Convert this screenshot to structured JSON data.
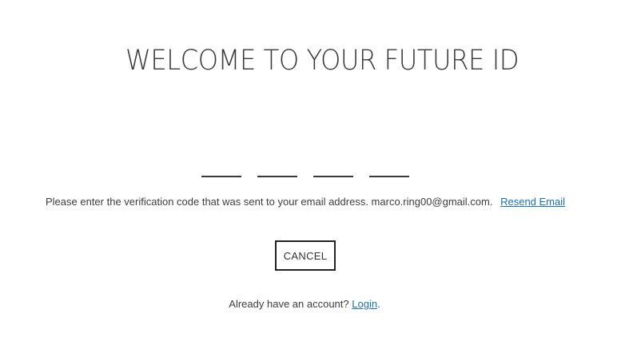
{
  "header": {
    "title": "WELCOME TO YOUR FUTURE ID"
  },
  "verification": {
    "code_digits": [
      "",
      "",
      "",
      ""
    ],
    "message": "Please enter the verification code that was sent to your email address. marco.ring00@gmail.com.",
    "resend_label": "Resend Email"
  },
  "actions": {
    "cancel_label": "CANCEL"
  },
  "footer": {
    "account_prompt": "Already have an account?",
    "login_label": "Login",
    "trailing_period": "."
  },
  "colors": {
    "link": "#1f6fae",
    "text": "#3d3d3d",
    "border": "#222222"
  }
}
